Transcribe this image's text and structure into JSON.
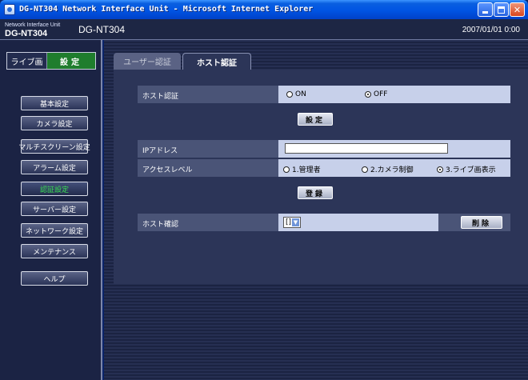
{
  "window": {
    "title": "DG-NT304 Network Interface Unit - Microsoft Internet Explorer"
  },
  "header": {
    "brand_small": "Network Interface Unit",
    "brand_large": "DG-NT304",
    "model": "DG-NT304",
    "datetime": "2007/01/01  0:00"
  },
  "mode": {
    "live": "ライブ画",
    "setup": "設定"
  },
  "sidebar": {
    "items": [
      {
        "label": "基本設定"
      },
      {
        "label": "カメラ設定"
      },
      {
        "label": "マルチスクリーン設定"
      },
      {
        "label": "アラーム設定"
      },
      {
        "label": "認証設定"
      },
      {
        "label": "サーバー設定"
      },
      {
        "label": "ネットワーク設定"
      },
      {
        "label": "メンテナンス"
      },
      {
        "label": "ヘルプ"
      }
    ],
    "active_index": 4
  },
  "tabs": [
    {
      "label": "ユーザー認証",
      "active": false
    },
    {
      "label": "ホスト認証",
      "active": true
    }
  ],
  "host_auth": {
    "label": "ホスト認証",
    "options": [
      "ON",
      "OFF"
    ],
    "selected": "OFF",
    "set_button": "設定"
  },
  "ip": {
    "label": "IPアドレス",
    "value": ""
  },
  "access": {
    "label": "アクセスレベル",
    "options": [
      "1.管理者",
      "2.カメラ制御",
      "3.ライブ画表示"
    ],
    "selected": "3.ライブ画表示",
    "register_button": "登録"
  },
  "host_confirm": {
    "label": "ホスト確認",
    "selected": "[]",
    "delete_button": "削除"
  },
  "colors": {
    "title_bar": "#0054e3",
    "setup_active": "#1f7d2d",
    "active_nav_text": "#38e053",
    "row_value_bg": "#c7d0ea"
  }
}
